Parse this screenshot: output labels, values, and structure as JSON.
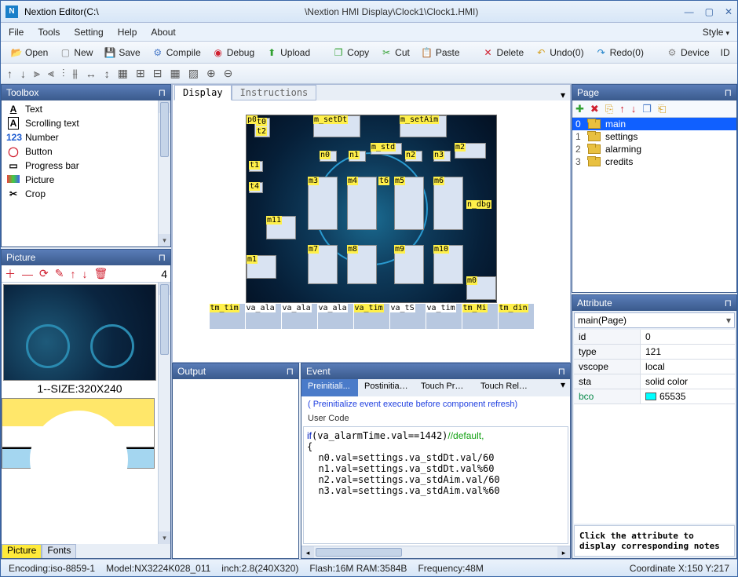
{
  "title_left": "Nextion Editor(C:\\",
  "title_mid": "\\Nextion HMI Display\\Clock1\\Clock1.HMI)",
  "menu": {
    "file": "File",
    "tools": "Tools",
    "setting": "Setting",
    "help": "Help",
    "about": "About",
    "style": "Style"
  },
  "tb1": {
    "open": "Open",
    "new": "New",
    "save": "Save",
    "compile": "Compile",
    "debug": "Debug",
    "upload": "Upload",
    "copy": "Copy",
    "cut": "Cut",
    "paste": "Paste",
    "delete": "Delete",
    "undo": "Undo(0)",
    "redo": "Redo(0)",
    "device": "Device",
    "id": "ID"
  },
  "toolbox": {
    "title": "Toolbox",
    "items": [
      "Text",
      "Scrolling text",
      "Number",
      "Button",
      "Progress bar",
      "Picture",
      "Crop"
    ]
  },
  "picture_panel": {
    "title": "Picture",
    "count": "4",
    "caption1": "1--SIZE:320X240",
    "tab_pic": "Picture",
    "tab_font": "Fonts"
  },
  "canvas": {
    "tab_display": "Display",
    "tab_instr": "Instructions"
  },
  "components": {
    "p0": "p0",
    "t0": "t0",
    "t2": "t2",
    "m_setDt": "m_setDt",
    "m_setAim": "m_setAim",
    "m_std": "m_std",
    "m2": "m2",
    "n0": "n0",
    "n1": "n1",
    "n2": "n2",
    "n3": "n3",
    "t1": "t1",
    "t4": "t4",
    "m3": "m3",
    "m4": "m4",
    "t6": "t6",
    "m5": "m5",
    "m6": "m6",
    "n_dbg": "n_dbg",
    "m11": "m11",
    "m7": "m7",
    "m8": "m8",
    "m9": "m9",
    "m10": "m10",
    "m1": "m1",
    "m0": "m0"
  },
  "timers": [
    "tm_tim",
    "va_ala",
    "va_ala",
    "va_ala",
    "va_tim",
    "va_tS",
    "va_tim",
    "tm_Mi",
    "tm_din"
  ],
  "output": {
    "title": "Output"
  },
  "event": {
    "title": "Event",
    "tabs": {
      "pre": "Preinitiali...",
      "post": "Postinitiali...",
      "press": "Touch Pres...",
      "rel": "Touch Rele..."
    },
    "hint": "( Preinitialize event execute before component refresh)",
    "uc": "User Code"
  },
  "code_lines": [
    {
      "t": "kw",
      "s": "if"
    },
    {
      "t": "p",
      "s": "(va_alarmTime.val==1442)"
    },
    {
      "t": "cm",
      "s": "//default,"
    },
    {
      "t": "br",
      "s": ""
    },
    {
      "t": "p",
      "s": "{"
    },
    {
      "t": "br",
      "s": ""
    },
    {
      "t": "p",
      "s": "  n0.val=settings.va_stdDt.val/60"
    },
    {
      "t": "br",
      "s": ""
    },
    {
      "t": "p",
      "s": "  n1.val=settings.va_stdDt.val%60"
    },
    {
      "t": "br",
      "s": ""
    },
    {
      "t": "p",
      "s": "  n2.val=settings.va_stdAim.val/60"
    },
    {
      "t": "br",
      "s": ""
    },
    {
      "t": "p",
      "s": "  n3.val=settings.va_stdAim.val%60"
    }
  ],
  "page": {
    "title": "Page",
    "items": [
      {
        "idx": "0",
        "name": "main"
      },
      {
        "idx": "1",
        "name": "settings"
      },
      {
        "idx": "2",
        "name": "alarming"
      },
      {
        "idx": "3",
        "name": "credits"
      }
    ]
  },
  "attr": {
    "title": "Attribute",
    "selector": "main(Page)",
    "rows": [
      {
        "k": "id",
        "v": "0"
      },
      {
        "k": "type",
        "v": "121"
      },
      {
        "k": "vscope",
        "v": "local"
      },
      {
        "k": "sta",
        "v": "solid color"
      },
      {
        "k": "bco",
        "v": "65535",
        "bco": true
      }
    ],
    "note": "Click the attribute to display corresponding notes"
  },
  "status": {
    "enc": "Encoding:iso-8859-1",
    "model": "Model:NX3224K028_011",
    "inch": "inch:2.8(240X320)",
    "flash": "Flash:16M RAM:3584B",
    "freq": "Frequency:48M",
    "coord": "Coordinate X:150   Y:217"
  }
}
